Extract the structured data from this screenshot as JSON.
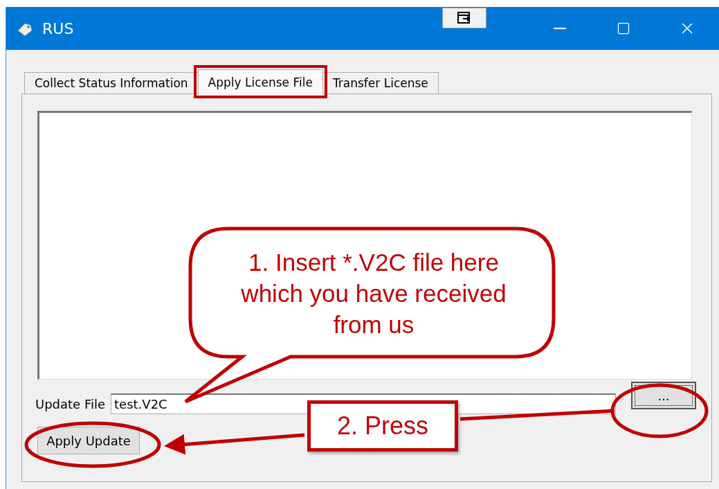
{
  "window": {
    "title": "RUS"
  },
  "tabs": [
    {
      "label": "Collect Status Information",
      "selected": false
    },
    {
      "label": "Apply License File",
      "selected": true
    },
    {
      "label": "Transfer License",
      "selected": false
    }
  ],
  "update_file": {
    "label": "Update File",
    "value": "test.V2C"
  },
  "browse_button": "...",
  "apply_button": "Apply Update",
  "annotations": [
    {
      "kind": "callout",
      "text": "1. Insert *.V2C file here which you have received from us"
    },
    {
      "kind": "box",
      "text": "2. Press"
    }
  ]
}
